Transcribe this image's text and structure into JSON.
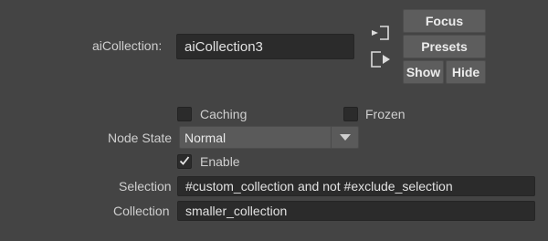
{
  "node": {
    "label": "aiCollection:",
    "name_value": "aiCollection3"
  },
  "buttons": {
    "focus": "Focus",
    "presets": "Presets",
    "show": "Show",
    "hide": "Hide"
  },
  "icons": {
    "input_connection": "input-connection-icon",
    "output_connection": "output-connection-icon"
  },
  "checkboxes": {
    "caching": {
      "label": "Caching",
      "checked": false
    },
    "frozen": {
      "label": "Frozen",
      "checked": false
    },
    "enable": {
      "label": "Enable",
      "checked": true
    }
  },
  "node_state": {
    "label": "Node State",
    "value": "Normal"
  },
  "selection": {
    "label": "Selection",
    "value": "#custom_collection and not #exclude_selection"
  },
  "collection": {
    "label": "Collection",
    "value": "smaller_collection"
  },
  "colors": {
    "background": "#444444",
    "field": "#2b2b2b",
    "button": "#5d5d5d"
  }
}
